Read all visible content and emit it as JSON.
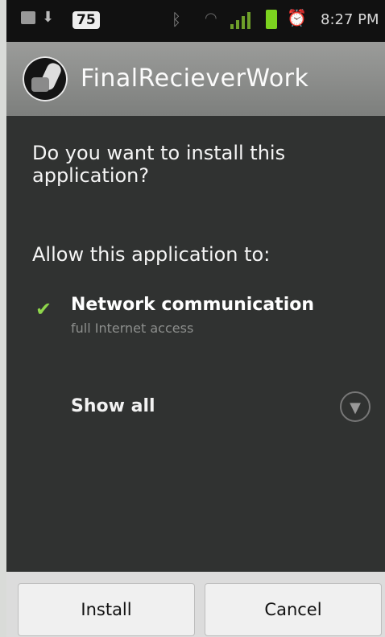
{
  "status_bar": {
    "badge": "75",
    "time": "8:27 PM"
  },
  "title_bar": {
    "app_name": "FinalRecieverWork"
  },
  "content": {
    "question": "Do you want to install this application?",
    "allow_heading": "Allow this application to:",
    "permissions": [
      {
        "title": "Network communication",
        "subtitle": "full Internet access"
      }
    ],
    "show_all": "Show all"
  },
  "buttons": {
    "install": "Install",
    "cancel": "Cancel"
  }
}
